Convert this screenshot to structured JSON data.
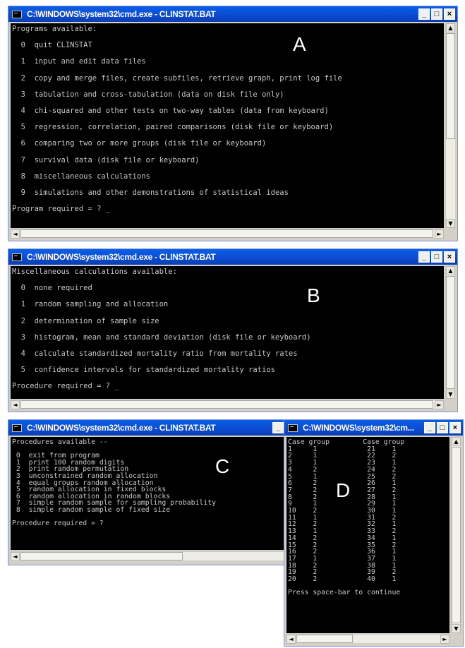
{
  "windows": {
    "a": {
      "title": "C:\\WINDOWS\\system32\\cmd.exe - CLINSTAT.BAT",
      "label": "A",
      "lines": [
        "Programs available:",
        "",
        "  0  quit CLINSTAT",
        "",
        "  1  input and edit data files",
        "",
        "  2  copy and merge files, create subfiles, retrieve graph, print log file",
        "",
        "  3  tabulation and cross-tabulation (data on disk file only)",
        "",
        "  4  chi-squared and other tests on two-way tables (data from keyboard)",
        "",
        "  5  regression, correlation, paired comparisons (disk file or keyboard)",
        "",
        "  6  comparing two or more groups (disk file or keyboard)",
        "",
        "  7  survival data (disk file or keyboard)",
        "",
        "  8  miscellaneous calculations",
        "",
        "  9  simulations and other demonstrations of statistical ideas",
        "",
        "Program required = ? _"
      ]
    },
    "b": {
      "title": "C:\\WINDOWS\\system32\\cmd.exe - CLINSTAT.BAT",
      "label": "B",
      "lines": [
        "Miscellaneous calculations available:",
        "",
        "  0  none required",
        "",
        "  1  random sampling and allocation",
        "",
        "  2  determination of sample size",
        "",
        "  3  histogram, mean and standard deviation (disk file or keyboard)",
        "",
        "  4  calculate standardized mortality ratio from mortality rates",
        "",
        "  5  confidence intervals for standardized mortality ratios",
        "",
        "Procedure required = ? _"
      ]
    },
    "c": {
      "title": "C:\\WINDOWS\\system32\\cmd.exe - CLINSTAT.BAT",
      "label": "C",
      "lines": [
        "Procedures available --",
        "",
        " 0  exit from program",
        " 1  print 100 random digits",
        " 2  print random permutation",
        " 3  unconstrained random allocation",
        " 4  equal groups random allocation",
        " 5  random allocation in fixed blocks",
        " 6  random allocation in random blocks",
        " 7  simple random sample for sampling probability",
        " 8  simple random sample of fixed size",
        "",
        "Procedure required = ?"
      ]
    },
    "d": {
      "title": "C:\\WINDOWS\\system32\\cm...",
      "label": "D",
      "lines": [
        "Case group        Case group",
        "1     1            21    1",
        "2     1            22    2",
        "3     1            23    1",
        "4     2            24    2",
        "5     1            25    2",
        "6     2            26    1",
        "7     2            27    2",
        "8     2            28    1",
        "9     1            29    1",
        "10    2            30    1",
        "11    1            31    2",
        "12    2            32    1",
        "13    1            33    2",
        "14    2            34    1",
        "15    2            35    2",
        "16    2            36    1",
        "17    1            37    1",
        "18    2            38    1",
        "19    2            39    2",
        "20    2            40    1",
        "",
        "Press space-bar to continue"
      ]
    }
  },
  "controls": {
    "minimize": "_",
    "maximize": "□",
    "close": "×",
    "arrow_up": "▲",
    "arrow_down": "▼",
    "arrow_left": "◄",
    "arrow_right": "►"
  }
}
